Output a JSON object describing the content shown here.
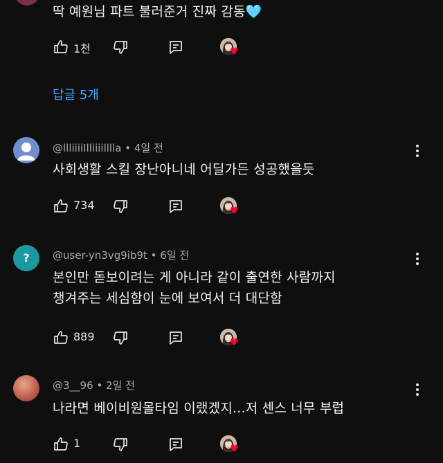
{
  "comments": [
    {
      "text_lines": [
        "딱 예원님 파트 불러준거 진짜 감동🩵"
      ],
      "likes": "1천",
      "replies_label": "답글 5개"
    },
    {
      "handle": "@llliiiiIlliiiilllla",
      "age": "4일 전",
      "text_lines": [
        "사회생활 스킬 장난아니네 어딜가든 성공했을듯"
      ],
      "likes": "734"
    },
    {
      "handle": "@user-yn3vg9ib9t",
      "age": "6일 전",
      "avatar_letter": "?",
      "text_lines": [
        "본인만 돋보이려는 게 아니라 같이 출연한 사람까지",
        "챙겨주는 세심함이 눈에 보여서 더 대단함"
      ],
      "likes": "889"
    },
    {
      "handle": "@3__96",
      "age": "2일 전",
      "text_lines": [
        "나라면 베이비원몰타임 이랬겠지...저 센스 너무 부럽"
      ],
      "likes": "1"
    }
  ],
  "colors": {
    "background": "#0f0f0f",
    "link": "#3ea6ff",
    "heart": "#ff0033",
    "avatar_blue": "#6f8fd0",
    "avatar_teal": "#1a9aa0"
  },
  "icons": [
    "thumbs-up-icon",
    "thumbs-down-icon",
    "reply-icon",
    "creator-heart-icon",
    "more-vert-icon",
    "default-avatar-icon"
  ]
}
